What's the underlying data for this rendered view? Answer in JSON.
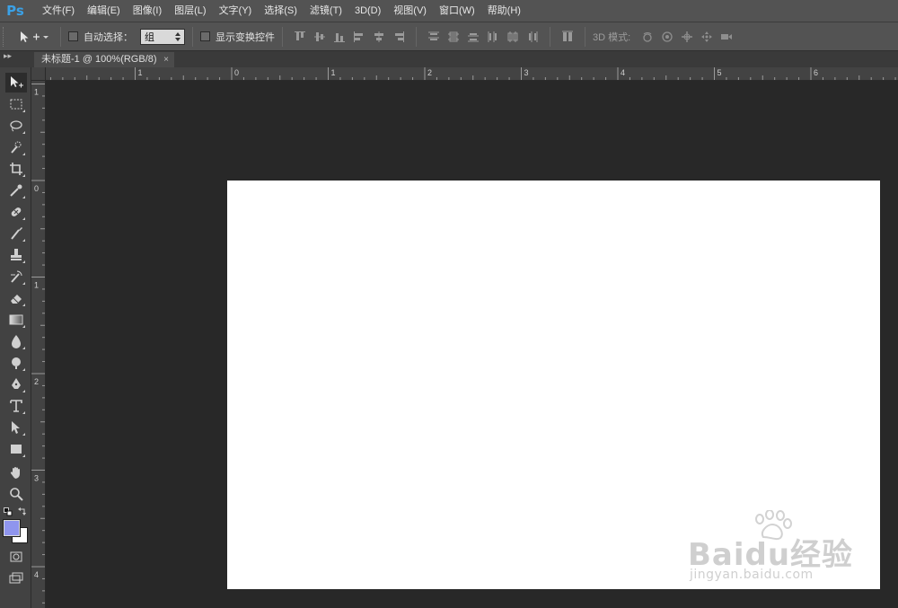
{
  "app": {
    "logo": "Ps"
  },
  "menu": [
    "文件(F)",
    "编辑(E)",
    "图像(I)",
    "图层(L)",
    "文字(Y)",
    "选择(S)",
    "滤镜(T)",
    "3D(D)",
    "视图(V)",
    "窗口(W)",
    "帮助(H)"
  ],
  "options": {
    "auto_select_label": "自动选择：",
    "auto_select_value": "组",
    "transform_label": "显示变换控件",
    "mode_3d_label": "3D 模式:"
  },
  "tabs": {
    "collapse": "▸▸",
    "document": "未标题-1 @ 100%(RGB/8)",
    "close": "×"
  },
  "rulers": {
    "h_labels": [
      "1",
      "0",
      "1",
      "2",
      "3",
      "4",
      "5",
      "6"
    ],
    "v_labels": [
      "1",
      "0",
      "1",
      "2",
      "3",
      "4"
    ]
  },
  "colors": {
    "foreground": "#8f95ee",
    "background": "#ffffff",
    "canvas": "#ffffff",
    "accent": "#3ba1e6"
  },
  "watermark": {
    "brand": "Baidu经验",
    "url": "jingyan.baidu.com"
  },
  "tools": [
    "move-tool",
    "marquee-tool",
    "lasso-tool",
    "quick-select-tool",
    "crop-tool",
    "eyedropper-tool",
    "healing-brush-tool",
    "brush-tool",
    "clone-stamp-tool",
    "history-brush-tool",
    "eraser-tool",
    "gradient-tool",
    "blur-tool",
    "dodge-tool",
    "pen-tool",
    "type-tool",
    "path-select-tool",
    "rectangle-tool",
    "hand-tool",
    "zoom-tool"
  ]
}
